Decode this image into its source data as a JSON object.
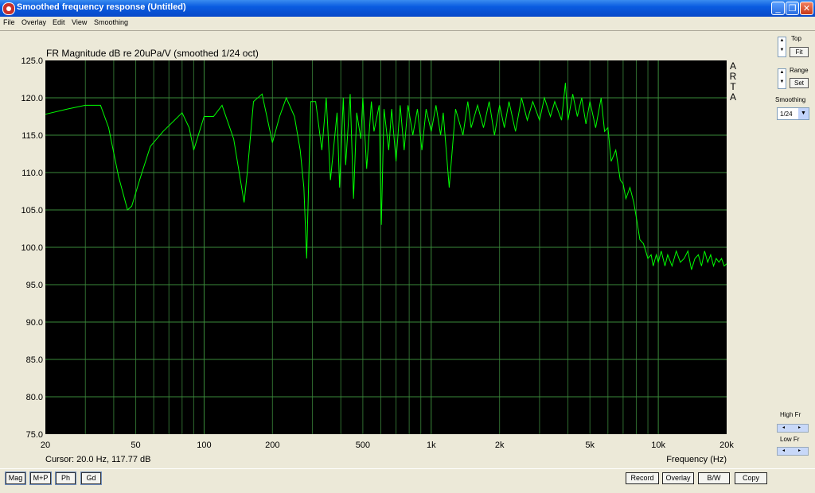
{
  "window": {
    "title": "Smoothed frequency response (Untitled)"
  },
  "menu": [
    "File",
    "Overlay",
    "Edit",
    "View",
    "Smoothing"
  ],
  "chart_data": {
    "type": "line",
    "title": "FR Magnitude dB re 20uPa/V (smoothed 1/24 oct)",
    "xlabel": "Frequency (Hz)",
    "ylabel": "",
    "xscale": "log",
    "xlim": [
      20,
      20000
    ],
    "ylim": [
      75,
      125
    ],
    "x_ticks": [
      20,
      50,
      100,
      200,
      500,
      1000,
      2000,
      5000,
      10000,
      20000
    ],
    "x_tick_labels": [
      "20",
      "50",
      "100",
      "200",
      "500",
      "1k",
      "2k",
      "5k",
      "10k",
      "20k"
    ],
    "y_ticks": [
      75,
      80,
      85,
      90,
      95,
      100,
      105,
      110,
      115,
      120,
      125
    ],
    "y_tick_labels": [
      "75.0",
      "80.0",
      "85.0",
      "90.0",
      "95.0",
      "100.0",
      "105.0",
      "110.0",
      "115.0",
      "120.0",
      "125.0"
    ],
    "grid": true,
    "background": "#000000",
    "line_color": "#00ff00",
    "watermark": [
      "A",
      "R",
      "T",
      "A"
    ],
    "series": [
      {
        "x": [
          20,
          25,
          30,
          35,
          38,
          42,
          46,
          48,
          52,
          58,
          66,
          80,
          86,
          90,
          100,
          110,
          120,
          135,
          150,
          155,
          165,
          180,
          200,
          215,
          230,
          250,
          265,
          275,
          283,
          295,
          310,
          330,
          345,
          360,
          385,
          395,
          410,
          420,
          440,
          455,
          470,
          490,
          500,
          520,
          545,
          560,
          590,
          603,
          620,
          650,
          670,
          700,
          730,
          760,
          790,
          830,
          870,
          910,
          950,
          1000,
          1050,
          1100,
          1130,
          1200,
          1280,
          1380,
          1450,
          1500,
          1600,
          1700,
          1800,
          1900,
          2000,
          2100,
          2200,
          2350,
          2500,
          2650,
          2800,
          3000,
          3150,
          3350,
          3500,
          3750,
          3900,
          4000,
          4200,
          4400,
          4600,
          4800,
          5000,
          5300,
          5600,
          5800,
          6000,
          6200,
          6500,
          6800,
          7000,
          7200,
          7500,
          7800,
          8000,
          8300,
          8600,
          8800,
          9000,
          9300,
          9500,
          9800,
          10000,
          10300,
          10700,
          11000,
          11500,
          12000,
          12500,
          13000,
          13500,
          14000,
          14500,
          15000,
          15500,
          16000,
          16500,
          17000,
          17500,
          18000,
          18500,
          19000,
          19500,
          20000
        ],
        "y": [
          117.8,
          118.5,
          119.0,
          119.0,
          116.0,
          109.5,
          105.0,
          105.5,
          109.0,
          113.5,
          115.5,
          118.0,
          116.0,
          113.0,
          117.5,
          117.5,
          119.0,
          114.5,
          106.0,
          110.0,
          119.5,
          120.5,
          114.0,
          117.5,
          120.0,
          117.5,
          113.0,
          108.0,
          98.5,
          119.5,
          119.5,
          113.0,
          120.0,
          109.0,
          118.0,
          108.0,
          120.0,
          111.0,
          120.5,
          106.5,
          118.0,
          114.5,
          120.0,
          110.5,
          119.5,
          115.5,
          119.0,
          103.0,
          118.5,
          113.0,
          118.5,
          111.5,
          119.0,
          113.0,
          119.0,
          115.0,
          118.5,
          113.0,
          118.5,
          115.5,
          119.0,
          115.0,
          118.0,
          108.0,
          118.5,
          115.0,
          119.5,
          116.0,
          119.0,
          116.0,
          119.5,
          115.0,
          119.0,
          116.0,
          119.5,
          115.5,
          120.0,
          117.0,
          119.5,
          117.0,
          120.0,
          117.5,
          119.5,
          117.0,
          122.0,
          117.0,
          120.5,
          117.5,
          120.0,
          116.5,
          119.5,
          116.0,
          120.0,
          115.5,
          116.0,
          111.5,
          113.0,
          109.0,
          108.5,
          106.5,
          108.0,
          106.0,
          104.0,
          101.0,
          100.5,
          99.5,
          98.5,
          99.0,
          97.5,
          99.0,
          98.0,
          99.5,
          97.5,
          99.0,
          97.5,
          99.5,
          98.0,
          98.5,
          99.5,
          97.0,
          98.5,
          99.0,
          97.5,
          99.5,
          98.0,
          99.0,
          97.5,
          98.5,
          98.0,
          98.5,
          97.5,
          97.8
        ]
      }
    ]
  },
  "cursor_readout": "Cursor: 20.0 Hz, 117.77 dB",
  "sidebar": {
    "top_label": "Top",
    "fit_button": "Fit",
    "range_label": "Range",
    "set_button": "Set",
    "smoothing_label": "Smoothing",
    "smoothing_value": "1/24",
    "high_fr_label": "High Fr",
    "low_fr_label": "Low Fr"
  },
  "bottom_left_buttons": [
    "Mag",
    "M+P",
    "Ph",
    "Gd"
  ],
  "bottom_right_buttons": [
    "Record",
    "Overlay",
    "B/W",
    "Copy"
  ],
  "icons": {
    "spin_up": "▲",
    "spin_down": "▼",
    "dropdown_arrow": "▼",
    "arrow_left": "◂",
    "arrow_right": "▸",
    "minimize": "_",
    "maximize": "❐",
    "close": "✕"
  }
}
